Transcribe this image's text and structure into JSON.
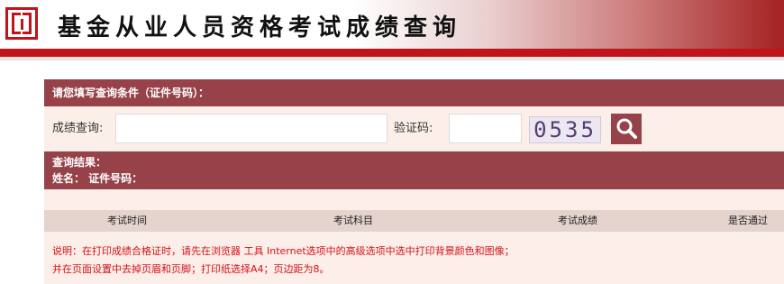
{
  "header": {
    "title": "基金从业人员资格考试成绩查询"
  },
  "query_section": {
    "heading": "请您填写查询条件（证件号码）：",
    "score_label": "成绩查询:",
    "score_input_value": "",
    "captcha_label": "验证码:",
    "captcha_input_value": "",
    "captcha_code": "0535"
  },
  "result_section": {
    "heading": "查询结果：",
    "name_line": "姓名：  证件号码："
  },
  "table": {
    "columns": [
      "考试时间",
      "考试科目",
      "考试成绩",
      "是否通过"
    ]
  },
  "notes": [
    "说明：在打印成绩合格证时，请先在浏览器 工具 Internet选项中的高级选项中选中打印背景颜色和图像；",
    "并在页面设置中去掉页眉和页脚；打印纸选择A4；页边距为8。"
  ],
  "colors": {
    "brand_red": "#c0141a",
    "panel_bar": "#974249",
    "panel_bg": "#fcefe9",
    "table_header_bg": "#e5d3cd",
    "note_text": "#d4111a"
  }
}
